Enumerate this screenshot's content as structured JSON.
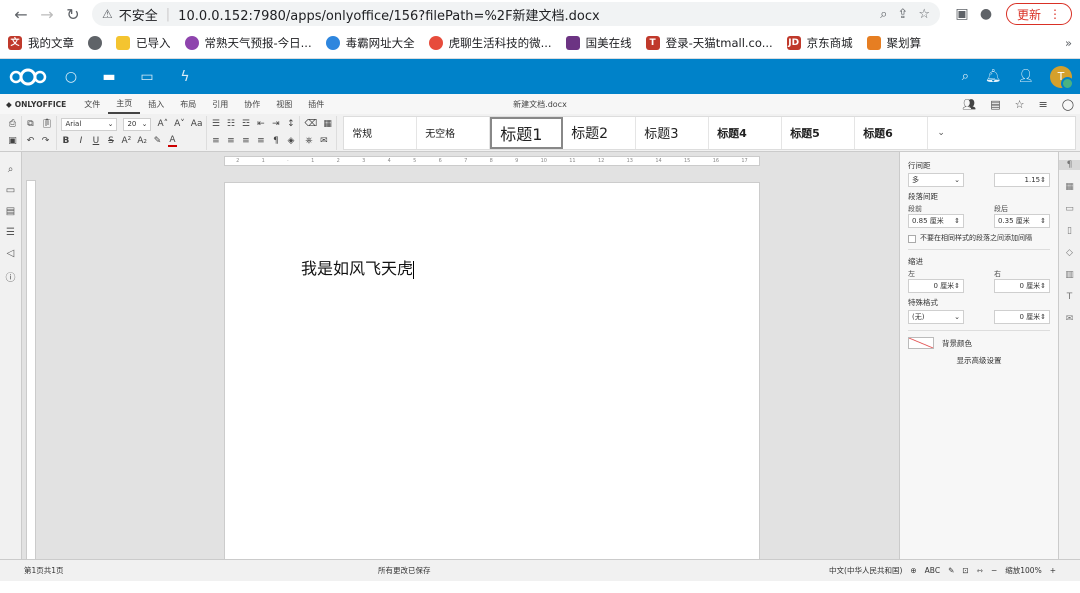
{
  "browser": {
    "security": "不安全",
    "url": "10.0.0.152:7980/apps/onlyoffice/156?filePath=%2F新建文档.docx",
    "update_label": "更新"
  },
  "bookmarks": [
    {
      "label": "我的文章",
      "color": "#c0392b"
    },
    {
      "label": "",
      "color": "#5f6368"
    },
    {
      "label": "已导入",
      "color": "#f4c430"
    },
    {
      "label": "常熟天气预报-今日...",
      "color": "#8e44ad"
    },
    {
      "label": "毒霸网址大全",
      "color": "#2e86de"
    },
    {
      "label": "虎聊生活科技的微...",
      "color": "#e74c3c"
    },
    {
      "label": "国美在线",
      "color": "#6c3483"
    },
    {
      "label": "登录-天猫tmall.co...",
      "color": "#c0392b"
    },
    {
      "label": "京东商城",
      "color": "#c0392b"
    },
    {
      "label": "聚划算",
      "color": "#e67e22"
    }
  ],
  "nextcloud": {
    "avatar_letter": "T"
  },
  "oo_menu": {
    "logo": "ONLYOFFICE",
    "tabs": [
      "文件",
      "主页",
      "插入",
      "布局",
      "引用",
      "协作",
      "视图",
      "插件"
    ],
    "active_tab": "主页",
    "doc_title": "新建文档.docx"
  },
  "toolbar": {
    "font_name": "Arial",
    "font_size": "20",
    "styles": [
      "常规",
      "无空格",
      "标题1",
      "标题2",
      "标题3",
      "标题4",
      "标题5",
      "标题6"
    ]
  },
  "document": {
    "text": "我是如风飞天虎"
  },
  "right_panel": {
    "line_spacing_label": "行间距",
    "line_spacing_mode": "多",
    "line_spacing_value": "1.15",
    "para_spacing_label": "段落间距",
    "before_label": "段前",
    "after_label": "段后",
    "before_value": "0.85 厘米",
    "after_value": "0.35 厘米",
    "no_space_label": "不要在相同样式的段落之间添加间隔",
    "indent_label": "缩进",
    "left_label": "左",
    "right_label": "右",
    "left_value": "0 厘米",
    "right_value": "0 厘米",
    "special_label": "特殊格式",
    "special_value": "(无)",
    "special_amount": "0 厘米",
    "bg_color_label": "背景颜色",
    "advanced_label": "显示高级设置"
  },
  "statusbar": {
    "page_info": "第1页共1页",
    "save_status": "所有更改已保存",
    "language": "中文(中华人民共和国)",
    "zoom": "缩放100%"
  }
}
